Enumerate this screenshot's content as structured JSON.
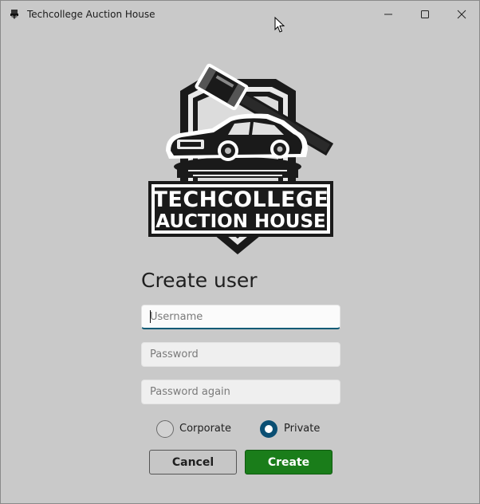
{
  "window": {
    "title": "Techcollege Auction House",
    "controls": [
      "minimize",
      "maximize",
      "close"
    ]
  },
  "logo": {
    "line1": "TECHCOLLEGE",
    "line2": "AUCTION HOUSE"
  },
  "form": {
    "heading": "Create user",
    "username": {
      "value": "",
      "placeholder": "Username"
    },
    "password": {
      "value": "",
      "placeholder": "Password"
    },
    "password_again": {
      "value": "",
      "placeholder": "Password again"
    },
    "account_type": {
      "options": [
        {
          "label": "Corporate",
          "selected": false
        },
        {
          "label": "Private",
          "selected": true
        }
      ]
    },
    "cancel_label": "Cancel",
    "create_label": "Create"
  },
  "colors": {
    "background": "#c9c9c9",
    "accent": "#0a4f73",
    "create_button": "#1a7d1a",
    "cancel_button": "#c6c6c6"
  }
}
